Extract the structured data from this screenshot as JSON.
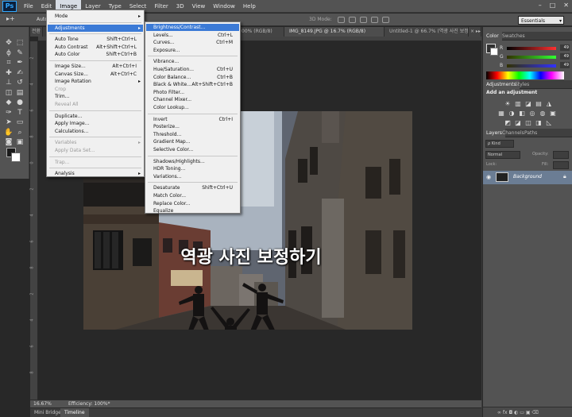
{
  "app": {
    "logo": "Ps",
    "menu": [
      "File",
      "Edit",
      "Image",
      "Layer",
      "Type",
      "Select",
      "Filter",
      "3D",
      "View",
      "Window",
      "Help"
    ],
    "active_menu_index": 2,
    "window_controls": [
      "–",
      "□",
      "✕"
    ]
  },
  "options_bar": {
    "tool_glyph": "▸+",
    "auto_label": "Auto",
    "mode_label": "3D Mode:",
    "workspace": "Essentials"
  },
  "doc_tabs": [
    "전환",
    "00% (RGB/8)",
    "IMG_8149.JPG @ 16.7% (RGB/8)",
    "Untitled-1 @ 66.7% (역광 사진 보정...",
    "× ▸▸"
  ],
  "ruler_numbers": [
    "2",
    "4",
    "6",
    "8",
    "0",
    "2",
    "4",
    "6",
    "8",
    "2",
    "4",
    "6",
    "8"
  ],
  "photo": {
    "caption": "역광 사진 보정하기",
    "sign_text": "ノーチ"
  },
  "status": {
    "zoom": "16.67%",
    "efficiency": "Efficiency: 100%*"
  },
  "bottom_tabs": [
    "Mini Bridge",
    "Timeline"
  ],
  "panels": {
    "color_tabs": [
      "Color",
      "Swatches"
    ],
    "sliders": [
      {
        "label": "R",
        "value": "49",
        "from": "#000000",
        "to": "#ff3131"
      },
      {
        "label": "G",
        "value": "49",
        "from": "#313100",
        "to": "#31ff31"
      },
      {
        "label": "B",
        "value": "49",
        "from": "#313100",
        "to": "#3131ff"
      }
    ],
    "adjust_tabs": [
      "Adjustments",
      "Styles"
    ],
    "adjust_title": "Add an adjustment",
    "adjust_icons_row1": [
      "☀",
      "▥",
      "◪",
      "▤",
      "◮"
    ],
    "adjust_icons_row2": [
      "▦",
      "◑",
      "◧",
      "◎",
      "◍",
      "▣"
    ],
    "adjust_icons_row3": [
      "◩",
      "◪",
      "◫",
      "◨",
      "◺"
    ],
    "layers_tabs": [
      "Layers",
      "Channels",
      "Paths"
    ],
    "kind_label": "ρ Kind",
    "blend_mode": "Normal",
    "opacity_label": "Opacity:",
    "lock_label": "Lock:",
    "fill_label": "Fill:",
    "layer_name": "Background",
    "footer_icons": "∞  fx  ◘  ◐  ▭  ▣  ⌫"
  },
  "image_menu": {
    "items": [
      {
        "label": "Mode",
        "shortcut": "",
        "submenu": true,
        "disabled": false
      },
      {
        "sep": true
      },
      {
        "label": "Adjustments",
        "shortcut": "",
        "submenu": true,
        "disabled": false,
        "highlight": true
      },
      {
        "sep": true
      },
      {
        "label": "Auto Tone",
        "shortcut": "Shift+Ctrl+L",
        "disabled": false
      },
      {
        "label": "Auto Contrast",
        "shortcut": "Alt+Shift+Ctrl+L",
        "disabled": false
      },
      {
        "label": "Auto Color",
        "shortcut": "Shift+Ctrl+B",
        "disabled": false
      },
      {
        "sep": true
      },
      {
        "label": "Image Size...",
        "shortcut": "Alt+Ctrl+I",
        "disabled": false
      },
      {
        "label": "Canvas Size...",
        "shortcut": "Alt+Ctrl+C",
        "disabled": false
      },
      {
        "label": "Image Rotation",
        "shortcut": "",
        "submenu": true,
        "disabled": false
      },
      {
        "label": "Crop",
        "shortcut": "",
        "disabled": true
      },
      {
        "label": "Trim...",
        "shortcut": "",
        "disabled": false
      },
      {
        "label": "Reveal All",
        "shortcut": "",
        "disabled": true
      },
      {
        "sep": true
      },
      {
        "label": "Duplicate...",
        "shortcut": "",
        "disabled": false
      },
      {
        "label": "Apply Image...",
        "shortcut": "",
        "disabled": false
      },
      {
        "label": "Calculations...",
        "shortcut": "",
        "disabled": false
      },
      {
        "sep": true
      },
      {
        "label": "Variables",
        "shortcut": "",
        "submenu": true,
        "disabled": true
      },
      {
        "label": "Apply Data Set...",
        "shortcut": "",
        "disabled": true
      },
      {
        "sep": true
      },
      {
        "label": "Trap...",
        "shortcut": "",
        "disabled": true
      },
      {
        "sep": true
      },
      {
        "label": "Analysis",
        "shortcut": "",
        "submenu": true,
        "disabled": false
      }
    ]
  },
  "adjustments_menu": {
    "items": [
      {
        "label": "Brightness/Contrast...",
        "shortcut": "",
        "highlight": true
      },
      {
        "label": "Levels...",
        "shortcut": "Ctrl+L"
      },
      {
        "label": "Curves...",
        "shortcut": "Ctrl+M"
      },
      {
        "label": "Exposure...",
        "shortcut": ""
      },
      {
        "sep": true
      },
      {
        "label": "Vibrance...",
        "shortcut": ""
      },
      {
        "label": "Hue/Saturation...",
        "shortcut": "Ctrl+U"
      },
      {
        "label": "Color Balance...",
        "shortcut": "Ctrl+B"
      },
      {
        "label": "Black & White...",
        "shortcut": "Alt+Shift+Ctrl+B"
      },
      {
        "label": "Photo Filter...",
        "shortcut": ""
      },
      {
        "label": "Channel Mixer...",
        "shortcut": ""
      },
      {
        "label": "Color Lookup...",
        "shortcut": ""
      },
      {
        "sep": true
      },
      {
        "label": "Invert",
        "shortcut": "Ctrl+I"
      },
      {
        "label": "Posterize...",
        "shortcut": ""
      },
      {
        "label": "Threshold...",
        "shortcut": ""
      },
      {
        "label": "Gradient Map...",
        "shortcut": ""
      },
      {
        "label": "Selective Color...",
        "shortcut": ""
      },
      {
        "sep": true
      },
      {
        "label": "Shadows/Highlights...",
        "shortcut": ""
      },
      {
        "label": "HDR Toning...",
        "shortcut": ""
      },
      {
        "label": "Variations...",
        "shortcut": ""
      },
      {
        "sep": true
      },
      {
        "label": "Desaturate",
        "shortcut": "Shift+Ctrl+U"
      },
      {
        "label": "Match Color...",
        "shortcut": ""
      },
      {
        "label": "Replace Color...",
        "shortcut": ""
      },
      {
        "label": "Equalize",
        "shortcut": ""
      }
    ]
  },
  "tools": [
    {
      "name": "move-tool-icon",
      "glyph": "✥"
    },
    {
      "name": "marquee-tool-icon",
      "glyph": "⬚"
    },
    {
      "name": "lasso-tool-icon",
      "glyph": "ϕ"
    },
    {
      "name": "quick-select-tool-icon",
      "glyph": "✎"
    },
    {
      "name": "crop-tool-icon",
      "glyph": "⌗"
    },
    {
      "name": "eyedropper-tool-icon",
      "glyph": "✒"
    },
    {
      "name": "healing-brush-icon",
      "glyph": "✚"
    },
    {
      "name": "brush-tool-icon",
      "glyph": "✍"
    },
    {
      "name": "clone-stamp-icon",
      "glyph": "⊥"
    },
    {
      "name": "history-brush-icon",
      "glyph": "↺"
    },
    {
      "name": "eraser-tool-icon",
      "glyph": "◫"
    },
    {
      "name": "gradient-tool-icon",
      "glyph": "▤"
    },
    {
      "name": "blur-tool-icon",
      "glyph": "◆"
    },
    {
      "name": "dodge-tool-icon",
      "glyph": "●"
    },
    {
      "name": "pen-tool-icon",
      "glyph": "✑"
    },
    {
      "name": "type-tool-icon",
      "glyph": "T"
    },
    {
      "name": "path-select-icon",
      "glyph": "➤"
    },
    {
      "name": "shape-tool-icon",
      "glyph": "▭"
    },
    {
      "name": "hand-tool-icon",
      "glyph": "✋"
    },
    {
      "name": "zoom-tool-icon",
      "glyph": "⌕"
    },
    {
      "name": "quick-mask-icon",
      "glyph": "◙"
    },
    {
      "name": "screen-mode-icon",
      "glyph": "▣"
    }
  ]
}
